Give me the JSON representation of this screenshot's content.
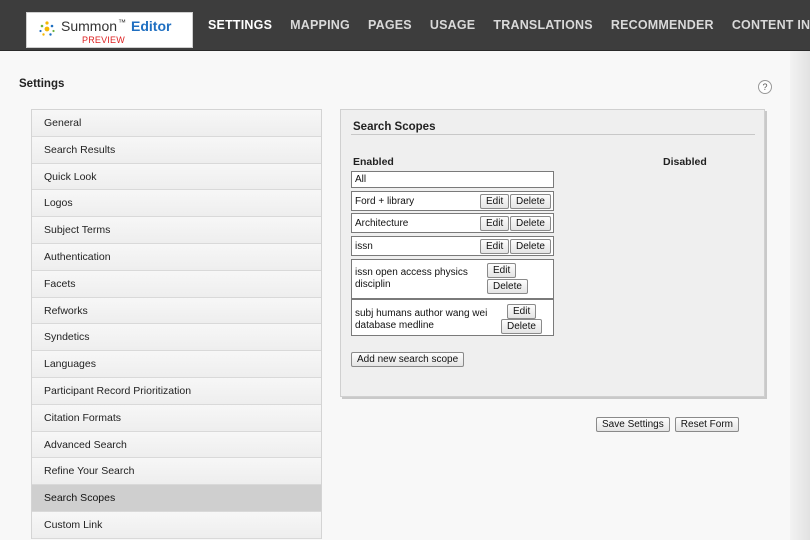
{
  "header": {
    "brand": "Summon",
    "trademark": "™",
    "product": "Editor",
    "badge": "PREVIEW",
    "nav": [
      "SETTINGS",
      "MAPPING",
      "PAGES",
      "USAGE",
      "TRANSLATIONS",
      "RECOMMENDER",
      "CONTENT IN"
    ]
  },
  "page": {
    "title": "Settings",
    "help": "?"
  },
  "sidebar": {
    "items": [
      "General",
      "Search Results",
      "Quick Look",
      "Logos",
      "Subject Terms",
      "Authentication",
      "Facets",
      "Refworks",
      "Syndetics",
      "Languages",
      "Participant Record Prioritization",
      "Citation Formats",
      "Advanced Search",
      "Refine Your Search",
      "Search Scopes",
      "Custom Link"
    ],
    "active": "Search Scopes"
  },
  "panel": {
    "title": "Search Scopes",
    "enabled_label": "Enabled",
    "disabled_label": "Disabled",
    "edit_label": "Edit",
    "delete_label": "Delete",
    "add_label": "Add new search scope",
    "scopes": [
      {
        "name": "All"
      },
      {
        "name": "Ford + library"
      },
      {
        "name": "Architecture"
      },
      {
        "name": "issn"
      },
      {
        "name": "issn open access physics disciplin"
      },
      {
        "name": "subj humans author wang wei database medline"
      }
    ]
  },
  "footer": {
    "save_label": "Save Settings",
    "reset_label": "Reset Form"
  },
  "colors": {
    "topbar": "#3d3d3d",
    "brand_blue": "#1f6fc1",
    "preview_red": "#dd2222",
    "active_item": "#cfcfcf"
  }
}
